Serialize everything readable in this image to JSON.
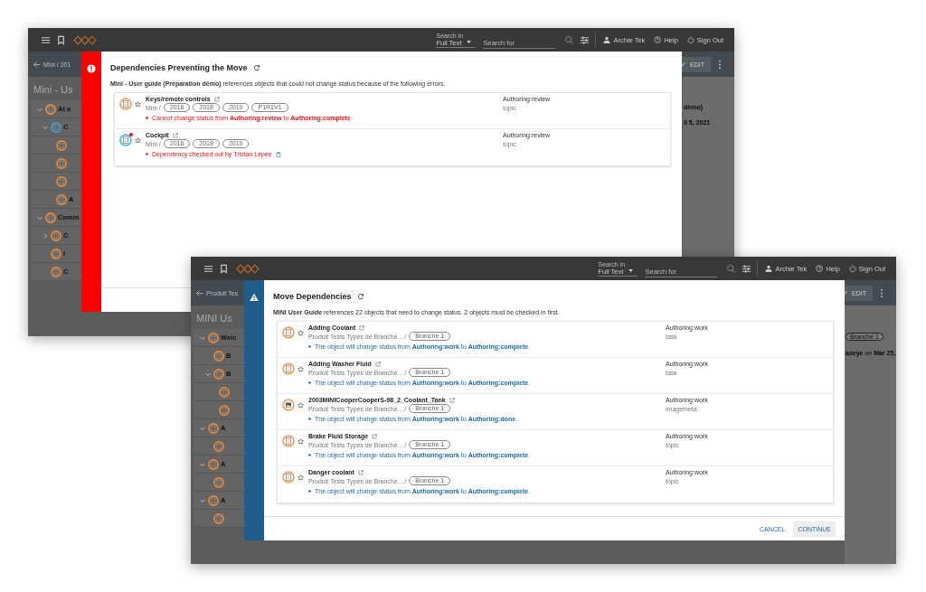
{
  "windows": [
    {
      "header": {
        "search_label": "Search in",
        "search_scope": "Full Text",
        "search_placeholder": "Search for",
        "user": "Archie Tek",
        "help": "Help",
        "sign_out": "Sign Out"
      },
      "page": {
        "breadcrumb": "Mini / 201",
        "title": "Mini - Us",
        "edit": "EDIT",
        "side": [
          {
            "kind": "text",
            "text": "**démo)**"
          },
          {
            "kind": "text",
            "text": "**il 5, 2021**"
          }
        ],
        "tree": [
          {
            "label": "At a",
            "expanded": true,
            "color": "#e8873a",
            "children": [
              {
                "label": "C",
                "expanded": true,
                "color": "#3aa0d8",
                "children": [
                  {
                    "color": "#e8873a"
                  },
                  {
                    "color": "#e8873a"
                  },
                  {
                    "color": "#e8873a"
                  },
                  {
                    "label": "A",
                    "color": "#e8873a"
                  }
                ]
              }
            ]
          },
          {
            "label": "Comm",
            "expanded": true,
            "color": "#e8873a",
            "children": [
              {
                "label": "C",
                "expanded": false,
                "color": "#e8873a"
              },
              {
                "label": "I",
                "color": "#e8873a"
              },
              {
                "label": "C",
                "color": "#e8873a"
              }
            ]
          }
        ]
      },
      "dialog": {
        "kind": "error",
        "title": "Dependencies Preventing the Move",
        "description": "**Mini - User guide (Préparation démo)** references objects that could not change status because of the following errors.",
        "rows": [
          {
            "title": "Keys/remote controls",
            "kind": "document",
            "color": "#f0a35e",
            "checked_out": false,
            "path": "Mini /",
            "chips": [
              "2016",
              "2018",
              "2019",
              "P1R1V1"
            ],
            "message": "Cannot change status from **Authoring:review** to **Authoring:complete**",
            "status": "Authoring:review",
            "type": "topic"
          },
          {
            "title": "Cockpit",
            "kind": "document",
            "color": "#4fb6e0",
            "checked_out": true,
            "path": "Mini /",
            "chips": [
              "2016",
              "2018",
              "2019"
            ],
            "message": "Dependency checked out by Tristan Lépée",
            "status": "Authoring:review",
            "type": "topic"
          }
        ]
      }
    },
    {
      "header": {
        "search_label": "Search in",
        "search_scope": "Full Text",
        "search_placeholder": "Search for",
        "user": "Archie Tek",
        "help": "Help",
        "sign_out": "Sign Out"
      },
      "page": {
        "breadcrumb": "Produit Tes",
        "title": "MINI Us",
        "edit": "EDIT",
        "side": [
          {
            "kind": "chip",
            "text": "Branche 1"
          },
          {
            "kind": "text",
            "text": "**aseye** on **Mar 25,**"
          }
        ],
        "tree": [
          {
            "label": "Welc",
            "expanded": true,
            "color": "#e8873a",
            "children": [
              {
                "label": "B",
                "color": "#e8873a"
              },
              {
                "label": "B",
                "expanded": true,
                "color": "#e8873a",
                "children": [
                  {
                    "color": "#e8873a"
                  },
                  {
                    "color": "#e8873a"
                  }
                ]
              }
            ]
          },
          {
            "label": "A",
            "expanded": true,
            "color": "#e8873a",
            "children": [
              {
                "color": "#e8873a"
              }
            ]
          },
          {
            "label": "A",
            "expanded": true,
            "color": "#e8873a",
            "children": [
              {
                "color": "#e8873a"
              }
            ]
          },
          {
            "label": "A",
            "expanded": true,
            "color": "#e8873a",
            "children": [
              {
                "color": "#e8873a"
              }
            ]
          }
        ]
      },
      "dialog": {
        "kind": "warning",
        "title": "Move Dependencies",
        "description": "**MINI User Guide** references 22 objects that need to change status. 2 objects must be checked in first.",
        "rows": [
          {
            "title": "Adding Coolant",
            "kind": "document",
            "color": "#f0a35e",
            "checked_out": false,
            "path": "Produit Tests Types de Branche... /",
            "chips": [
              "Branche 1"
            ],
            "message": "The object will change status from **Authoring:work** to **Authoring:complete**.",
            "status": "Authoring:work",
            "type": "task"
          },
          {
            "title": "Adding Washer Fluid",
            "kind": "document",
            "color": "#f0a35e",
            "checked_out": false,
            "path": "Produit Tests Types de Branche... /",
            "chips": [
              "Branche 1"
            ],
            "message": "The object will change status from **Authoring:work** to **Authoring:complete**.",
            "status": "Authoring:work",
            "type": "task"
          },
          {
            "title": "2003MINICooperCooperS-98_2_Coolant_Tank",
            "kind": "image",
            "color": "#f0a35e",
            "checked_out": false,
            "path": "Produit Tests Types de Branche... /",
            "chips": [
              "Branche 1"
            ],
            "message": "The object will change status from **Authoring:work** to **Authoring:done**.",
            "status": "Authoring:work",
            "type": "imagemeta"
          },
          {
            "title": "Brake Fluid Storage",
            "kind": "document",
            "color": "#f0a35e",
            "checked_out": false,
            "path": "Produit Tests Types de Branche... /",
            "chips": [
              "Branche 1"
            ],
            "message": "The object will change status from **Authoring:work** to **Authoring:complete**.",
            "status": "Authoring:work",
            "type": "topic"
          },
          {
            "title": "Danger coolant",
            "kind": "document",
            "color": "#f0a35e",
            "checked_out": false,
            "path": "Produit Tests Types de Branche... /",
            "chips": [
              "Branche 1"
            ],
            "message": "The object will change status from **Authoring:work** to **Authoring:complete**.",
            "status": "Authoring:work",
            "type": "topic"
          }
        ],
        "buttons": [
          {
            "label": "CANCEL",
            "primary": false
          },
          {
            "label": "CONTINUE",
            "primary": true
          }
        ]
      }
    }
  ]
}
